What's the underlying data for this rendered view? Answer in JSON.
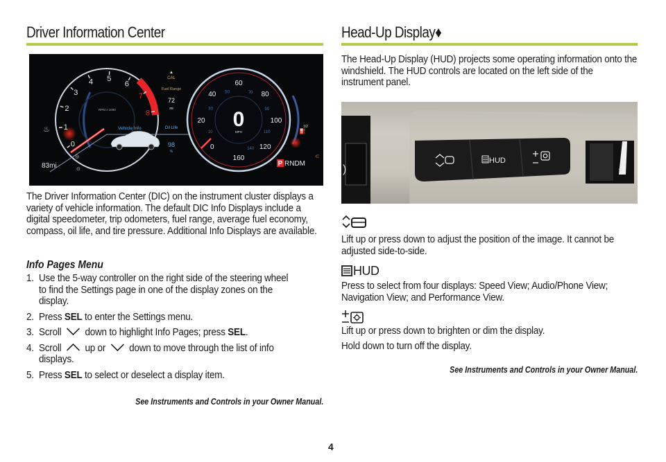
{
  "page": {
    "number": "4",
    "accent_color": "#b5c84a"
  },
  "left": {
    "title": "Driver Information Center",
    "cluster": {
      "tach_labels": [
        "0",
        "1",
        "2",
        "3",
        "4",
        "5",
        "6",
        "7",
        "8"
      ],
      "tach_caption": "RPM x 1000",
      "speed_labels_major": [
        "0",
        "20",
        "40",
        "60",
        "80",
        "100",
        "120",
        "160"
      ],
      "speed_labels_minor": [
        "10",
        "30",
        "50",
        "70",
        "90",
        "110",
        "140"
      ],
      "speed_value": "0",
      "speed_unit": "MPH",
      "cal_label": "CAL",
      "fuel_range_label": "Fuel Range",
      "fuel_range_value": "72",
      "fuel_range_unit": "mi",
      "vehicle_info_label": "Vehicle Info",
      "oil_life_label": "Oil Life",
      "oil_life_value": "98",
      "oil_life_unit": "%",
      "odometer": "83mi",
      "fuel_half": "1/2",
      "gear_selected": "P",
      "gear_rest": "RNDM",
      "colors": {
        "accent_red": "#e8262a",
        "info_blue": "#5aa9e6",
        "fuel_amber": "#d6b25a",
        "lamp_green": "#7fd33a"
      }
    },
    "intro": "The Driver Information Center (DIC) on the instrument cluster displays a variety of vehicle information. The default DIC Info Displays include a digital speedometer, trip odometers, fuel range, average fuel economy, compass, oil life, and tire pressure. Additional Info Displays are available.",
    "subhead": "Info Pages Menu",
    "steps": [
      {
        "num": "1.",
        "pre": "Use the 5-way controller on the right side of the steering wheel to find the Settings page in one of the display zones on the display."
      },
      {
        "num": "2.",
        "pre": "Press ",
        "bold": "SEL",
        "post": " to enter the Settings menu."
      },
      {
        "num": "3.",
        "pre": "Scroll ",
        "icon1": "chevron-down-icon",
        "mid": " down to highlight Info Pages; press ",
        "bold": "SEL",
        "post": "."
      },
      {
        "num": "4.",
        "pre": "Scroll ",
        "icon1": "chevron-up-icon",
        "mid": " up or ",
        "icon2": "chevron-down-icon",
        "post": " down to move through the list of info displays."
      },
      {
        "num": "5.",
        "pre": "Press ",
        "bold": "SEL",
        "post": " to select or deselect a display item."
      }
    ],
    "see_ref": "See Instruments and Controls in your Owner Manual."
  },
  "right": {
    "title": "Head-Up Display♦",
    "intro": "The Head-Up Display (HUD) projects some operating information onto the windshield. The HUD controls are located on the left side of the instrument panel.",
    "photo": {
      "button_labels": [
        "",
        "HUD",
        ""
      ]
    },
    "items": [
      {
        "icon": "hud-position-icon",
        "text": "Lift up or press down to adjust the position of the image. It cannot be adjusted side-to-side."
      },
      {
        "icon": "hud-view-icon",
        "icon_label": "HUD",
        "text": "Press to select from four displays: Speed View; Audio/Phone View; Navigation View; and Performance View."
      },
      {
        "icon": "hud-brightness-icon",
        "text": "Lift up or press down to brighten or dim the display.",
        "text2": "Hold down to turn off the display."
      }
    ],
    "see_ref": "See Instruments and Controls in your Owner Manual."
  }
}
